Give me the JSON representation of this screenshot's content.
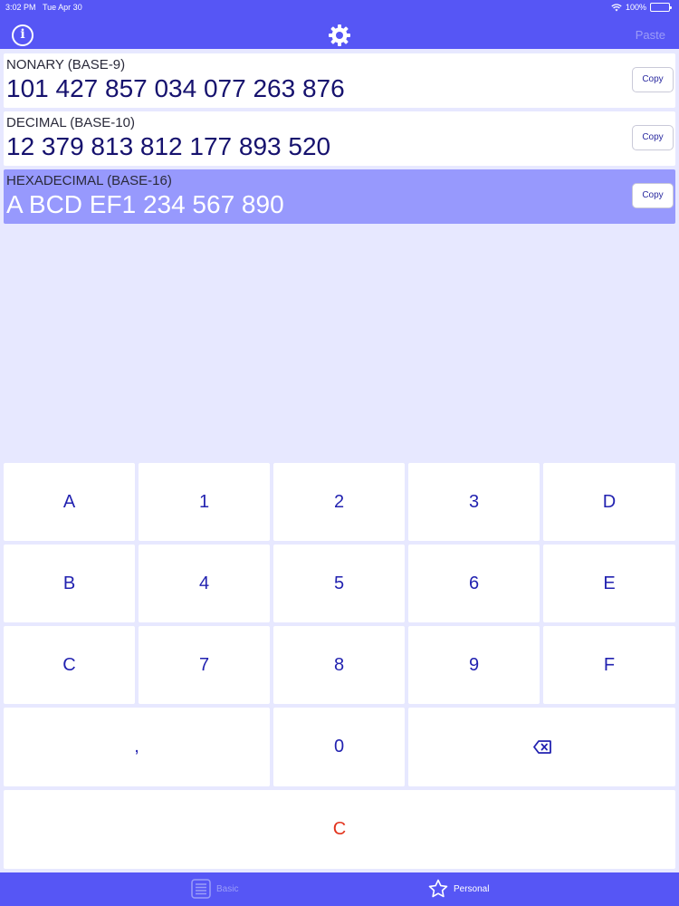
{
  "status": {
    "time": "3:02 PM",
    "date": "Tue Apr 30",
    "battery": "100%"
  },
  "header": {
    "info_icon": "info-icon",
    "settings_icon": "gear-icon",
    "paste_label": "Paste"
  },
  "rows": [
    {
      "label": "NONARY (BASE-9)",
      "value": "101 427 857 034 077 263 876",
      "copy_label": "Copy",
      "selected": false
    },
    {
      "label": "DECIMAL (BASE-10)",
      "value": "12 379 813 812 177 893 520",
      "copy_label": "Copy",
      "selected": false
    },
    {
      "label": "HEXADECIMAL (BASE-16)",
      "value": "A BCD EF1 234 567 890",
      "copy_label": "Copy",
      "selected": true
    }
  ],
  "keypad": {
    "keys": [
      "A",
      "1",
      "2",
      "3",
      "D",
      "B",
      "4",
      "5",
      "6",
      "E",
      "C",
      "7",
      "8",
      "9",
      "F",
      ",",
      "0"
    ],
    "backspace_icon": "backspace-icon",
    "clear_label": "C"
  },
  "tabbar": {
    "basic_label": "Basic",
    "personal_label": "Personal"
  },
  "colors": {
    "accent": "#5656f5",
    "selected_row": "#9799fd",
    "background": "#e7e8ff",
    "key_text": "#2222b0",
    "clear_text": "#e2341e"
  }
}
